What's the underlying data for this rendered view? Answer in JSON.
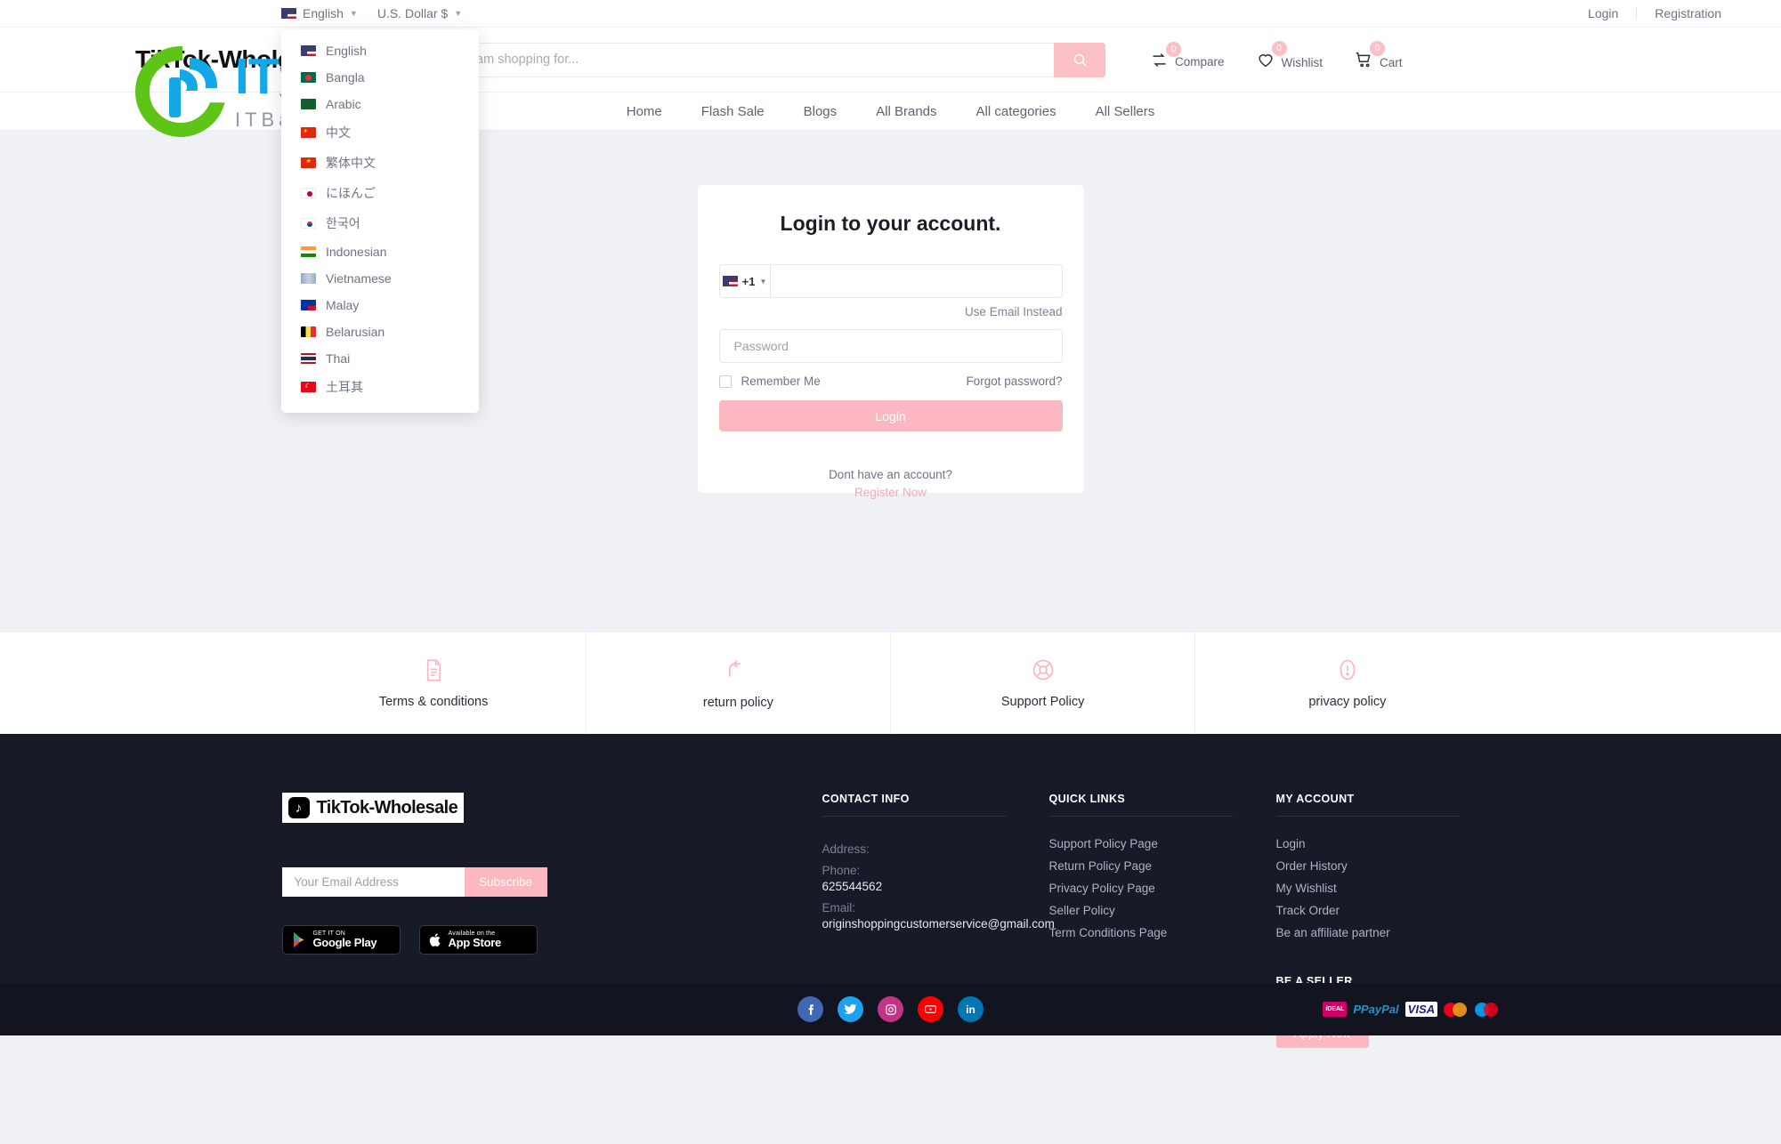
{
  "topbar": {
    "language": {
      "label": "English",
      "flag": "us-flag-icon"
    },
    "currency": {
      "label": "U.S. Dollar $"
    },
    "login": "Login",
    "registration": "Registration"
  },
  "language_dropdown": {
    "open": true,
    "items": [
      {
        "label": "English",
        "flag": "#3c3b6e"
      },
      {
        "label": "Bangla",
        "flag": "#006a4e"
      },
      {
        "label": "Arabic",
        "flag": "#165d31"
      },
      {
        "label": "中文",
        "flag": "#de2910"
      },
      {
        "label": "繁体中文",
        "flag": "#de2910"
      },
      {
        "label": "にほんご",
        "flag": "#ffffff"
      },
      {
        "label": "한국어",
        "flag": "#ffffff"
      },
      {
        "label": "Indonesian",
        "flag": "#ff9933"
      },
      {
        "label": "Vietnamese",
        "flag": "#8fa8c8"
      },
      {
        "label": "Malay",
        "flag": "#0032a0"
      },
      {
        "label": "Belarusian",
        "flag": "#000000"
      },
      {
        "label": "Thai",
        "flag": "#2d2a4a"
      },
      {
        "label": "土耳其",
        "flag": "#e30a17"
      }
    ]
  },
  "header": {
    "logo_text": "TikTok-Wholesale",
    "categories_button": "categories-menu",
    "search": {
      "placeholder": "I am shopping for...",
      "value": ""
    },
    "actions": [
      {
        "name": "compare",
        "label": "Compare",
        "count": "0"
      },
      {
        "name": "wishlist",
        "label": "Wishlist",
        "count": "0"
      },
      {
        "name": "cart",
        "label": "Cart",
        "count": "0"
      }
    ]
  },
  "nav": {
    "items": [
      "Home",
      "Flash Sale",
      "Blogs",
      "All Brands",
      "All categories",
      "All Sellers"
    ]
  },
  "login": {
    "title": "Login to your account.",
    "country_code": "+1",
    "phone_value": "",
    "phone_placeholder": "",
    "use_email": "Use Email Instead",
    "password_placeholder": "Password",
    "remember_me": "Remember Me",
    "forgot_password": "Forgot password?",
    "login_button": "Login",
    "no_account": "Dont have an account?",
    "register_now": "Register Now"
  },
  "policies": [
    {
      "label": "Terms & conditions",
      "icon": "document-icon"
    },
    {
      "label": "return policy",
      "icon": "return-arrow-icon"
    },
    {
      "label": "Support Policy",
      "icon": "lifebuoy-icon"
    },
    {
      "label": "privacy policy",
      "icon": "exclamation-circle-icon"
    }
  ],
  "footer": {
    "logo_text": "TikTok",
    "logo_suffix": "-Wholesale",
    "newsletter": {
      "placeholder": "Your Email Address",
      "button": "Subscribe"
    },
    "stores": [
      {
        "small": "GET IT ON",
        "big": "Google Play",
        "icon": "google-play-icon"
      },
      {
        "small": "Available on the",
        "big": "App Store",
        "icon": "apple-icon"
      }
    ],
    "contact": {
      "heading": "CONTACT INFO",
      "address_label": "Address:",
      "address_value": "",
      "phone_label": "Phone:",
      "phone_value": "625544562",
      "email_label": "Email:",
      "email_value": "originshoppingcustomerservice@gmail.com"
    },
    "quick_links": {
      "heading": "QUICK LINKS",
      "items": [
        "Support Policy Page",
        "Return Policy Page",
        "Privacy Policy Page",
        "Seller Policy",
        "Term Conditions Page"
      ]
    },
    "my_account": {
      "heading": "MY ACCOUNT",
      "items": [
        "Login",
        "Order History",
        "My Wishlist",
        "Track Order",
        "Be an affiliate partner"
      ]
    },
    "be_a_seller": {
      "heading": "BE A SELLER",
      "button": "Apply Now"
    },
    "socials": [
      {
        "name": "facebook-icon",
        "glyph": "f",
        "color": "#4267b2"
      },
      {
        "name": "twitter-icon",
        "glyph": "t",
        "color": "#1da1f2"
      },
      {
        "name": "instagram-icon",
        "glyph": "o",
        "color": "#c13584"
      },
      {
        "name": "youtube-icon",
        "glyph": "y",
        "color": "#ff0000"
      },
      {
        "name": "linkedin-icon",
        "glyph": "in",
        "color": "#0077b5"
      }
    ],
    "payments": [
      {
        "name": "ideal-icon",
        "label": "iDEAL"
      },
      {
        "name": "paypal-icon",
        "label": "PayPal"
      },
      {
        "name": "visa-icon",
        "label": "VISA"
      },
      {
        "name": "mastercard-icon",
        "label": "MasterCard"
      },
      {
        "name": "maestro-icon",
        "label": "Maestro"
      }
    ]
  },
  "watermark": {
    "main": "IT资源网",
    "sub": "ITBaiDu.com"
  },
  "colors": {
    "accent": "#fbb8c0",
    "footer_bg": "#171b28",
    "page_bg": "#f0f1f5"
  }
}
